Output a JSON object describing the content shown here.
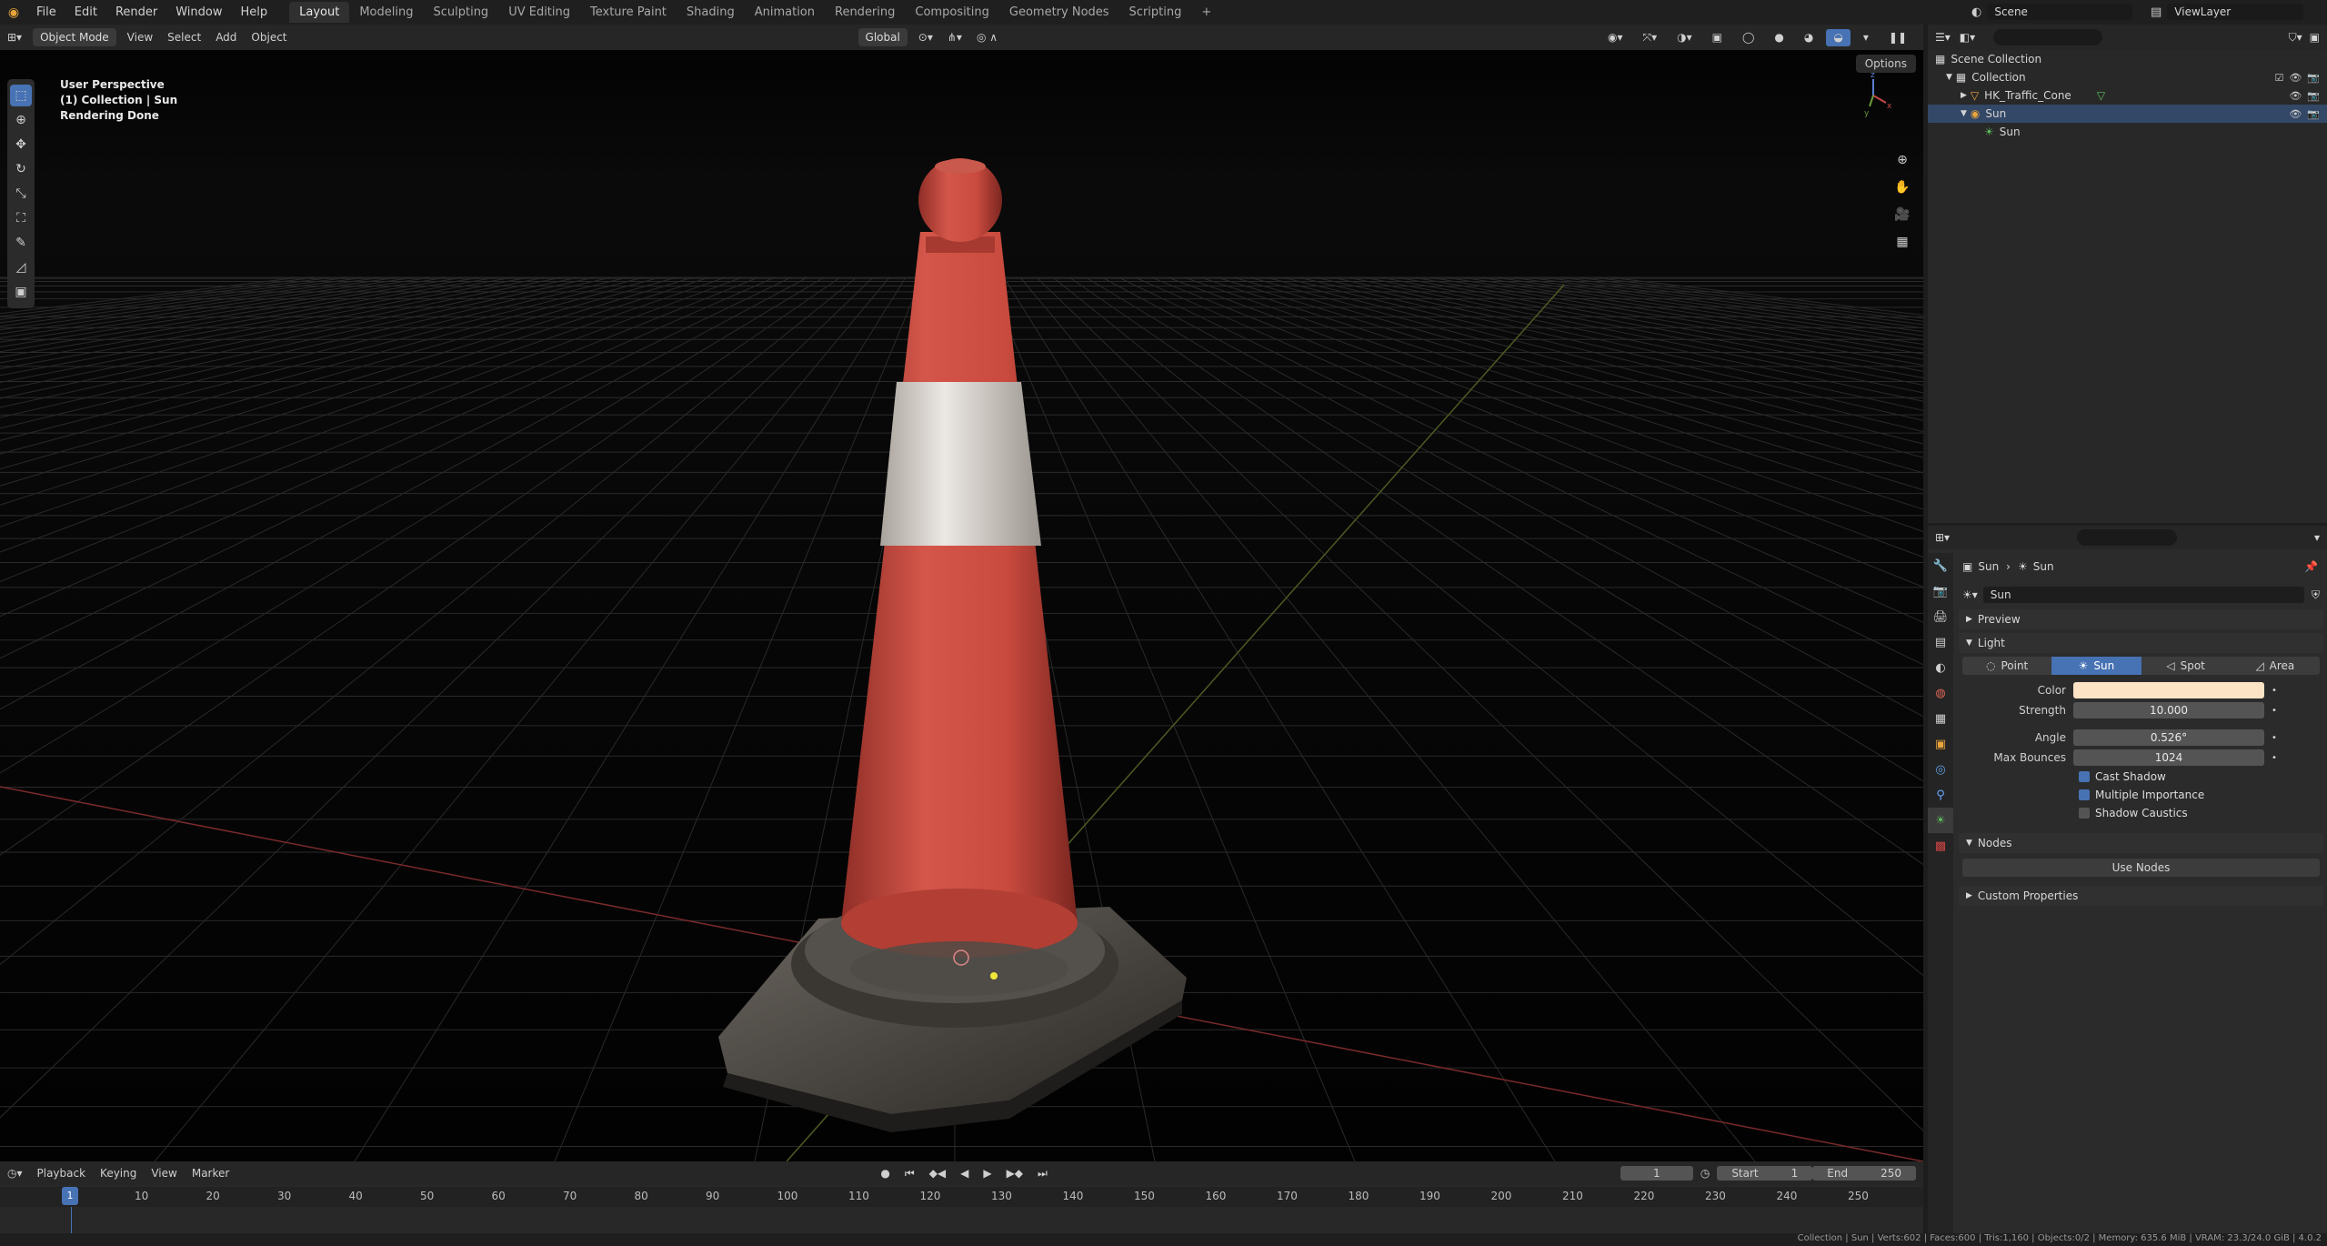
{
  "topbar": {
    "menus": [
      "File",
      "Edit",
      "Render",
      "Window",
      "Help"
    ],
    "workspaces": [
      "Layout",
      "Modeling",
      "Sculpting",
      "UV Editing",
      "Texture Paint",
      "Shading",
      "Animation",
      "Rendering",
      "Compositing",
      "Geometry Nodes",
      "Scripting"
    ],
    "active_workspace": "Layout",
    "scene_label": "Scene",
    "viewlayer_label": "ViewLayer"
  },
  "viewport_header": {
    "mode": "Object Mode",
    "menus": [
      "View",
      "Select",
      "Add",
      "Object"
    ],
    "orientation": "Global",
    "options_label": "Options"
  },
  "viewport": {
    "line1": "User Perspective",
    "line2": "(1) Collection | Sun",
    "line3": "Rendering Done"
  },
  "outliner": {
    "root": "Scene Collection",
    "collection": "Collection",
    "items": [
      {
        "name": "HK_Traffic_Cone"
      },
      {
        "name": "Sun"
      },
      {
        "name": "Sun"
      }
    ]
  },
  "properties": {
    "breadcrumb_obj": "Sun",
    "breadcrumb_data": "Sun",
    "datablock_name": "Sun",
    "sections": {
      "preview": "Preview",
      "light": "Light",
      "nodes": "Nodes",
      "custom": "Custom Properties"
    },
    "light_types": [
      "Point",
      "Sun",
      "Spot",
      "Area"
    ],
    "active_light_type": "Sun",
    "fields": {
      "color_label": "Color",
      "color_value": "#fde3c5",
      "strength_label": "Strength",
      "strength_value": "10.000",
      "angle_label": "Angle",
      "angle_value": "0.526°",
      "bounces_label": "Max Bounces",
      "bounces_value": "1024"
    },
    "checkboxes": [
      {
        "label": "Cast Shadow",
        "checked": true
      },
      {
        "label": "Multiple Importance",
        "checked": true
      },
      {
        "label": "Shadow Caustics",
        "checked": false
      }
    ],
    "use_nodes": "Use Nodes"
  },
  "timeline": {
    "menus": [
      "Playback",
      "Keying",
      "View",
      "Marker"
    ],
    "current_frame": "1",
    "start_label": "Start",
    "start_value": "1",
    "end_label": "End",
    "end_value": "250",
    "ticks": [
      "1",
      "10",
      "20",
      "30",
      "40",
      "50",
      "60",
      "70",
      "80",
      "90",
      "100",
      "110",
      "120",
      "130",
      "140",
      "150",
      "160",
      "170",
      "180",
      "190",
      "200",
      "210",
      "220",
      "230",
      "240",
      "250"
    ]
  },
  "statusbar": {
    "text": "Collection | Sun | Verts:602 | Faces:600 | Tris:1,160 | Objects:0/2 | Memory: 635.6 MiB | VRAM: 23.3/24.0 GiB | 4.0.2"
  },
  "colors": {
    "accent": "#4772b3",
    "cone_red": "#c8453a",
    "cone_white": "#e4dfd8"
  }
}
